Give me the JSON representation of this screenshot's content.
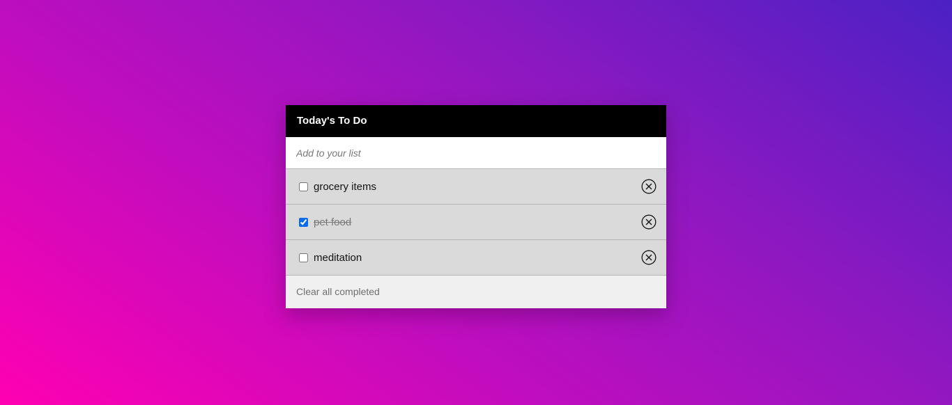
{
  "header": {
    "title": "Today's To Do"
  },
  "input": {
    "placeholder": "Add to your list",
    "value": ""
  },
  "todos": [
    {
      "label": "grocery items",
      "completed": false
    },
    {
      "label": "pet food",
      "completed": true
    },
    {
      "label": "meditation",
      "completed": false
    }
  ],
  "footer": {
    "clear_label": "Clear all completed"
  },
  "icons": {
    "remove": "close-circle-icon"
  },
  "colors": {
    "header_bg": "#000000",
    "item_bg": "#dadada",
    "checkbox_accent": "#0b6bf0"
  }
}
